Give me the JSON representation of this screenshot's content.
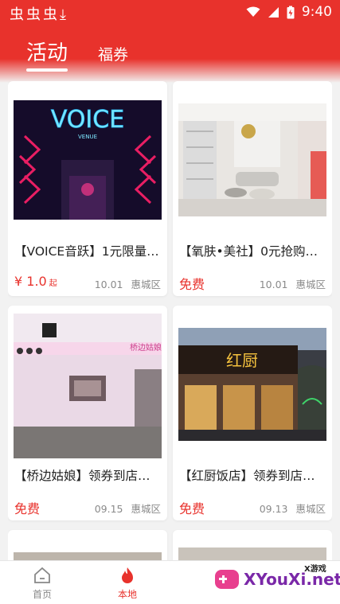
{
  "status_bar": {
    "time": "9:40"
  },
  "tabs": [
    {
      "label": "活动"
    },
    {
      "label": "福券"
    }
  ],
  "cards": [
    {
      "title": "【VOICE音跃】1元限量抢购价值...",
      "price": "¥ 1.0",
      "price_suffix": "起",
      "date": "10.01",
      "area": "惠城区",
      "image_text": "VOICE",
      "image_subtext": "VENUE"
    },
    {
      "title": "【氧肤•美社】0元抢购价值...",
      "price": "免费",
      "price_suffix": "",
      "date": "10.01",
      "area": "惠城区"
    },
    {
      "title": "【桥边姑娘】领券到店消费...",
      "price": "免费",
      "price_suffix": "",
      "date": "09.15",
      "area": "惠城区",
      "image_text": "桥边姑娘"
    },
    {
      "title": "【红厨饭店】领券到店消费...",
      "price": "免费",
      "price_suffix": "",
      "date": "09.13",
      "area": "惠城区",
      "image_text": "红厨"
    }
  ],
  "bottom_nav": [
    {
      "label": "首页"
    },
    {
      "label": "本地"
    }
  ],
  "watermark": {
    "text": "XYouXi.net",
    "top_text": "X游戏"
  },
  "colors": {
    "brand": "#e8322c",
    "muted": "#8a8a8a"
  }
}
